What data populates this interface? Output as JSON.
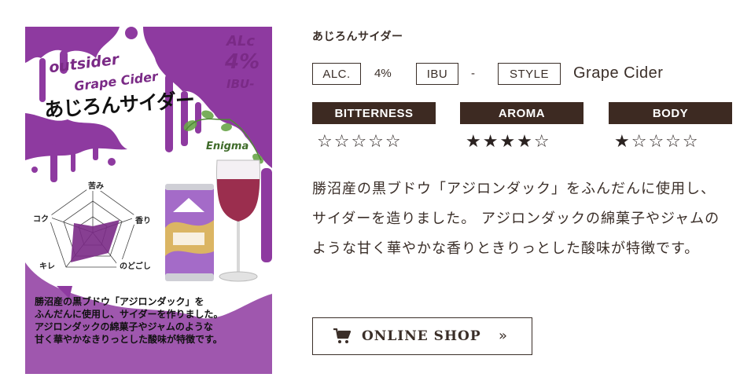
{
  "image": {
    "outsider": "outsider",
    "grape_cider": "Grape Cider",
    "name": "あじろんサイダー",
    "alc_label": "ALc",
    "alc_value": "4%",
    "ibu_label": "IBU-",
    "enigma": "Enigma",
    "radar_labels": {
      "top": "苦み",
      "right": "香り",
      "left": "コク",
      "bottom_left": "キレ",
      "bottom_right": "のどごし"
    },
    "description": "勝沼産の黒ブドウ「アジロンダック」を\nふんだんに使用し、サイダーを作りました。\nアジロンダックの綿菓子やジャムのような\n甘く華やかなきりっとした酸味が特徴です。",
    "brand_color": "#8e3aa0"
  },
  "product": {
    "title": "あじろんサイダー",
    "specs": {
      "alc_label": "ALC.",
      "alc_value": "4%",
      "ibu_label": "IBU",
      "ibu_value": "-",
      "style_label": "STYLE",
      "style_value": "Grape Cider"
    },
    "ratings": [
      {
        "label": "BITTERNESS",
        "value": 0,
        "max": 5,
        "stars": "☆☆☆☆☆"
      },
      {
        "label": "AROMA",
        "value": 4,
        "max": 5,
        "stars": "★★★★☆"
      },
      {
        "label": "BODY",
        "value": 1,
        "max": 5,
        "stars": "★☆☆☆☆"
      }
    ],
    "description": "勝沼産の黒ブドウ「アジロンダック」をふんだんに使用し、サイダーを造りました。 アジロンダックの綿菓子やジャムのような甘く華やかな香りときりっとした酸味が特徴です。",
    "shop_button": {
      "label": "ONLINE SHOP",
      "icon": "cart-icon",
      "arrow": "»"
    }
  },
  "colors": {
    "text": "#3a2e28",
    "header_bg": "#3d2a22",
    "accent_purple": "#8e3aa0"
  }
}
